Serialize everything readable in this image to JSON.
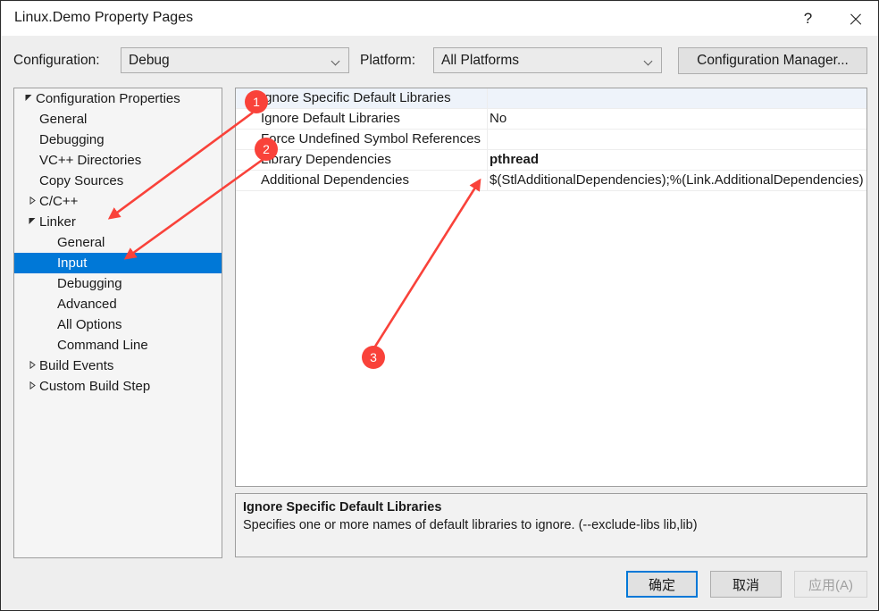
{
  "window": {
    "title": "Linux.Demo Property Pages",
    "help_icon": "help-icon",
    "help_glyph": "?",
    "close_icon": "close-icon"
  },
  "toolbar": {
    "configuration_label": "Configuration:",
    "configuration_value": "Debug",
    "platform_label": "Platform:",
    "platform_value": "All Platforms",
    "configuration_manager_label": "Configuration Manager..."
  },
  "tree": {
    "items": [
      {
        "label": "Configuration Properties",
        "level": 0,
        "expander": "expanded",
        "selected": false
      },
      {
        "label": "General",
        "level": 1,
        "expander": "none",
        "selected": false
      },
      {
        "label": "Debugging",
        "level": 1,
        "expander": "none",
        "selected": false
      },
      {
        "label": "VC++ Directories",
        "level": 1,
        "expander": "none",
        "selected": false
      },
      {
        "label": "Copy Sources",
        "level": 1,
        "expander": "none",
        "selected": false
      },
      {
        "label": "C/C++",
        "level": 1,
        "expander": "collapsed",
        "selected": false
      },
      {
        "label": "Linker",
        "level": 1,
        "expander": "expanded",
        "selected": false
      },
      {
        "label": "General",
        "level": 2,
        "expander": "none",
        "selected": false
      },
      {
        "label": "Input",
        "level": 2,
        "expander": "none",
        "selected": true
      },
      {
        "label": "Debugging",
        "level": 2,
        "expander": "none",
        "selected": false
      },
      {
        "label": "Advanced",
        "level": 2,
        "expander": "none",
        "selected": false
      },
      {
        "label": "All Options",
        "level": 2,
        "expander": "none",
        "selected": false
      },
      {
        "label": "Command Line",
        "level": 2,
        "expander": "none",
        "selected": false
      },
      {
        "label": "Build Events",
        "level": 1,
        "expander": "collapsed",
        "selected": false
      },
      {
        "label": "Custom Build Step",
        "level": 1,
        "expander": "collapsed",
        "selected": false
      }
    ]
  },
  "grid": {
    "rows": [
      {
        "name": "Ignore Specific Default Libraries",
        "value": "",
        "selected": true,
        "bold": false
      },
      {
        "name": "Ignore Default Libraries",
        "value": "No",
        "selected": false,
        "bold": false
      },
      {
        "name": "Force Undefined Symbol References",
        "value": "",
        "selected": false,
        "bold": false
      },
      {
        "name": "Library Dependencies",
        "value": "pthread",
        "selected": false,
        "bold": true
      },
      {
        "name": "Additional Dependencies",
        "value": "$(StlAdditionalDependencies);%(Link.AdditionalDependencies)",
        "selected": false,
        "bold": false
      }
    ]
  },
  "description": {
    "title": "Ignore Specific Default Libraries",
    "body": "Specifies one or more names of default libraries to ignore. (--exclude-libs lib,lib)"
  },
  "footer": {
    "ok_label": "确定",
    "cancel_label": "取消",
    "apply_label": "应用(A)"
  },
  "annotations": {
    "markers": [
      {
        "id": "1",
        "label": "1"
      },
      {
        "id": "2",
        "label": "2"
      },
      {
        "id": "3",
        "label": "3"
      }
    ],
    "color": "#f9423a"
  }
}
